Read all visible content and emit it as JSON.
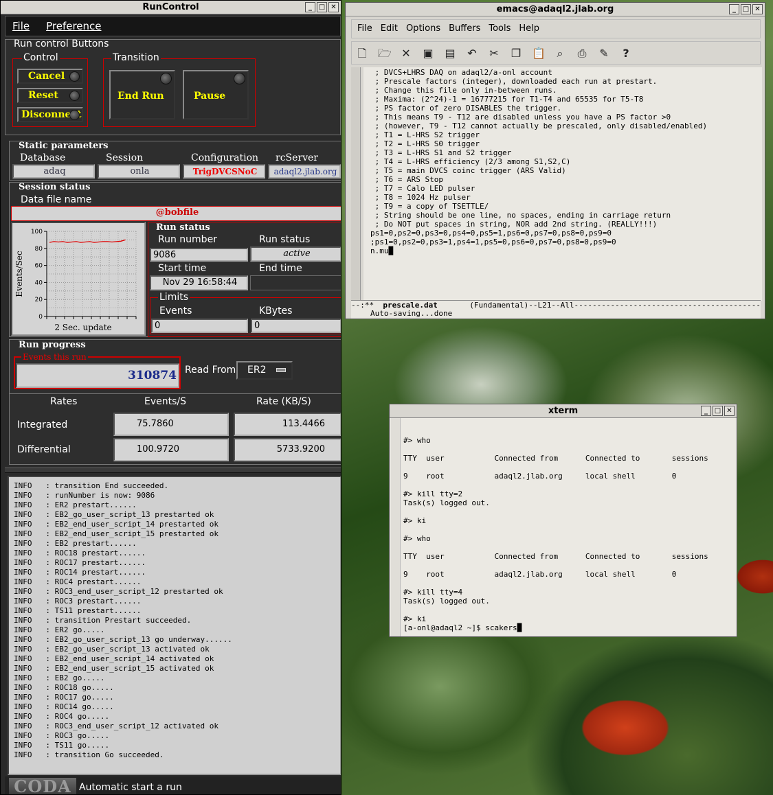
{
  "runcontrol": {
    "title": "RunControl",
    "menu": [
      "File",
      "Preference"
    ],
    "run_control_buttons_label": "Run control Buttons",
    "control_label": "Control",
    "control_buttons": [
      "Cancel",
      "Reset",
      "Disconnect"
    ],
    "transition_label": "Transition",
    "transition_buttons": [
      "End Run",
      "Pause"
    ],
    "static_params": {
      "label": "Static parameters",
      "database_label": "Database",
      "database": "adaq",
      "session_label": "Session",
      "session": "onla",
      "configuration_label": "Configuration",
      "configuration": "TrigDVCSNoC",
      "rcserver_label": "rcServer",
      "rcserver": "adaql2.jlab.org"
    },
    "session_status": {
      "label": "Session status",
      "data_file_label": "Data file name",
      "data_file": "@bobfile"
    },
    "chart_data": {
      "type": "line",
      "ylabel": "Events/Sec",
      "xlabel": "2 Sec. update",
      "ylim": [
        0,
        100
      ],
      "yticks": [
        "0",
        "20",
        "40",
        "60",
        "80",
        "100"
      ],
      "series": [
        {
          "values": [
            87,
            88,
            87.5,
            88,
            87,
            87.5,
            88,
            87,
            87.5,
            88,
            87,
            87.5,
            88,
            88,
            87.5,
            88,
            88.5,
            90
          ]
        }
      ],
      "line_color": "#e00000"
    },
    "run_status": {
      "label": "Run status",
      "run_number_label": "Run number",
      "run_number": "9086",
      "run_status_label": "Run status",
      "run_status": "active",
      "start_time_label": "Start time",
      "start_time": "Nov 29 16:58:44",
      "end_time_label": "End time",
      "end_time": "",
      "limits_label": "Limits",
      "events_label": "Events",
      "events": "0",
      "kbytes_label": "KBytes",
      "kbytes": "0"
    },
    "run_progress": {
      "label": "Run progress",
      "events_this_run_label": "Events this run",
      "events_this_run": "310874",
      "read_from_label": "Read From:",
      "read_from": "ER2"
    },
    "rates": {
      "rates_label": "Rates",
      "events_s_label": "Events/S",
      "rate_kb_label": "Rate (KB/S)",
      "integrated_label": "Integrated",
      "integrated_events": "75.7860",
      "integrated_rate": "113.4466",
      "differential_label": "Differential",
      "differential_events": "100.9720",
      "differential_rate": "5733.9200"
    },
    "log": [
      "INFO   : transition End succeeded.",
      "INFO   : runNumber is now: 9086",
      "INFO   : ER2 prestart......",
      "INFO   : EB2_go_user_script_13 prestarted ok",
      "INFO   : EB2_end_user_script_14 prestarted ok",
      "INFO   : EB2_end_user_script_15 prestarted ok",
      "INFO   : EB2 prestart......",
      "INFO   : ROC18 prestart......",
      "INFO   : ROC17 prestart......",
      "INFO   : ROC14 prestart......",
      "INFO   : ROC4 prestart......",
      "INFO   : ROC3_end_user_script_12 prestarted ok",
      "INFO   : ROC3 prestart......",
      "INFO   : TS11 prestart......",
      "INFO   : transition Prestart succeeded.",
      "INFO   : ER2 go.....",
      "INFO   : EB2_go_user_script_13 go underway......",
      "INFO   : EB2_go_user_script_13 activated ok",
      "INFO   : EB2_end_user_script_14 activated ok",
      "INFO   : EB2_end_user_script_15 activated ok",
      "INFO   : EB2 go.....",
      "INFO   : ROC18 go.....",
      "INFO   : ROC17 go.....",
      "INFO   : ROC14 go.....",
      "INFO   : ROC4 go.....",
      "INFO   : ROC3_end_user_script_12 activated ok",
      "INFO   : ROC3 go.....",
      "INFO   : TS11 go.....",
      "INFO   : transition Go succeeded."
    ],
    "footer_logo": "CODA",
    "footer_text": "Automatic start a run"
  },
  "emacs": {
    "title": "emacs@adaql2.jlab.org",
    "menu": [
      "File",
      "Edit",
      "Options",
      "Buffers",
      "Tools",
      "Help"
    ],
    "toolbar_icons": [
      "new-file-icon",
      "open-folder-icon",
      "close-icon",
      "save-icon",
      "save-as-icon",
      "undo-icon",
      "cut-icon",
      "copy-icon",
      "paste-icon",
      "search-icon",
      "print-icon",
      "customize-icon",
      "help-icon"
    ],
    "lines": [
      " ; DVCS+LHRS DAQ on adaql2/a-onl account",
      " ; Prescale factors (integer), downloaded each run at prestart.",
      " ; Change this file only in-between runs.",
      " ; Maxima: (2^24)-1 = 16777215 for T1-T4 and 65535 for T5-T8",
      " ; PS factor of zero DISABLES the trigger.",
      " ; This means T9 - T12 are disabled unless you have a PS factor >0",
      " ; (however, T9 - T12 cannot actually be prescaled, only disabled/enabled)",
      " ; T1 = L-HRS S2 trigger",
      " ; T2 = L-HRS S0 trigger",
      " ; T3 = L-HRS S1 and S2 trigger",
      " ; T4 = L-HRS efficiency (2/3 among S1,S2,C)",
      " ; T5 = main DVCS coinc trigger (ARS Valid)",
      " ; T6 = ARS Stop",
      " ; T7 = Calo LED pulser",
      " ; T8 = 1024 Hz pulser",
      " ; T9 = a copy of TSETTLE/",
      " ; String should be one line, no spaces, ending in carriage return",
      " ; Do NOT put spaces in string, NOR add 2nd string. (REALLY!!!)",
      "ps1=0,ps2=0,ps3=0,ps4=0,ps5=1,ps6=0,ps7=0,ps8=0,ps9=0",
      ";ps1=0,ps2=0,ps3=1,ps4=1,ps5=0,ps6=0,ps7=0,ps8=0,ps9=0",
      "n.mu█"
    ],
    "modeline_prefix": "--:**  ",
    "modeline_buffer": "prescale.dat",
    "modeline_rest": "       (Fundamental)--L21--All------------------------------------------",
    "echo": "Auto-saving...done"
  },
  "xterm": {
    "title": "xterm",
    "lines": [
      "",
      "",
      "#> who",
      "",
      "TTY  user           Connected from      Connected to       sessions",
      "",
      "9    root           adaql2.jlab.org     local shell        0",
      "",
      "#> kill tty=2",
      "Task(s) logged out.",
      "",
      "#> ki",
      "",
      "#> who",
      "",
      "TTY  user           Connected from      Connected to       sessions",
      "",
      "9    root           adaql2.jlab.org     local shell        0",
      "",
      "#> kill tty=4",
      "Task(s) logged out.",
      "",
      "#> ki",
      "[a-onl@adaql2 ~]$ scakers█"
    ]
  }
}
